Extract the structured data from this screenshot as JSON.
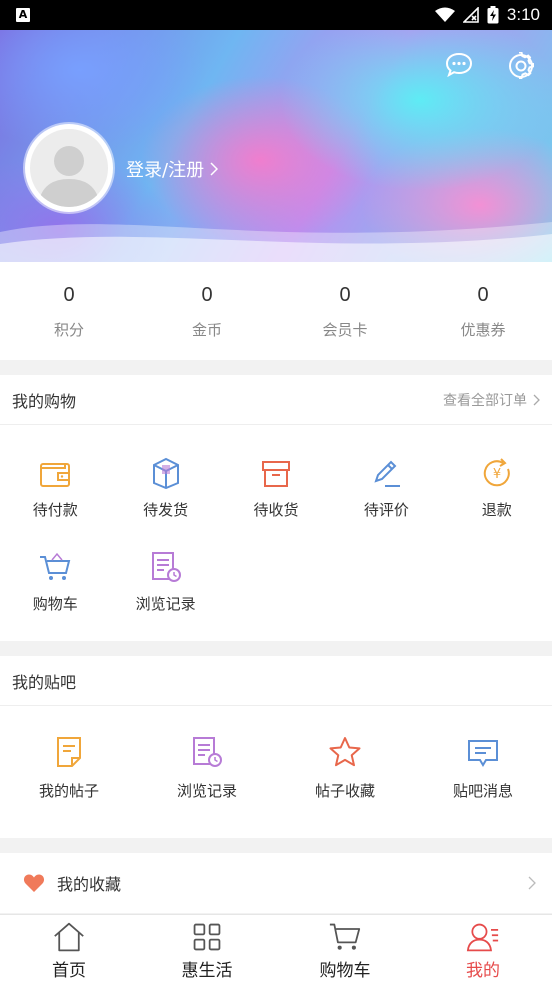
{
  "status_bar": {
    "app_badge": "A",
    "time": "3:10"
  },
  "header": {
    "login_label": "登录/注册"
  },
  "stats": [
    {
      "value": "0",
      "label": "积分"
    },
    {
      "value": "0",
      "label": "金币"
    },
    {
      "value": "0",
      "label": "会员卡"
    },
    {
      "value": "0",
      "label": "优惠券"
    }
  ],
  "shopping": {
    "title": "我的购物",
    "view_all": "查看全部订单",
    "items": [
      {
        "label": "待付款",
        "icon": "wallet-icon"
      },
      {
        "label": "待发货",
        "icon": "package-icon"
      },
      {
        "label": "待收货",
        "icon": "box-icon"
      },
      {
        "label": "待评价",
        "icon": "pen-icon"
      },
      {
        "label": "退款",
        "icon": "refund-icon"
      },
      {
        "label": "购物车",
        "icon": "cart-icon"
      },
      {
        "label": "浏览记录",
        "icon": "history-icon"
      }
    ]
  },
  "tieba": {
    "title": "我的贴吧",
    "items": [
      {
        "label": "我的帖子",
        "icon": "note-icon"
      },
      {
        "label": "浏览记录",
        "icon": "history-icon"
      },
      {
        "label": "帖子收藏",
        "icon": "star-icon"
      },
      {
        "label": "贴吧消息",
        "icon": "message-icon"
      }
    ]
  },
  "favorites": {
    "label": "我的收藏"
  },
  "tabbar": [
    {
      "label": "首页",
      "icon": "home-icon",
      "active": false
    },
    {
      "label": "惠生活",
      "icon": "grid-icon",
      "active": false
    },
    {
      "label": "购物车",
      "icon": "cart-icon",
      "active": false
    },
    {
      "label": "我的",
      "icon": "profile-icon",
      "active": true
    }
  ],
  "colors": {
    "active_tab": "#e64b4b",
    "icon_orange": "#f0a63a",
    "icon_blue": "#5b8fd6",
    "icon_purple": "#b77bd6",
    "icon_red": "#e8674b"
  }
}
